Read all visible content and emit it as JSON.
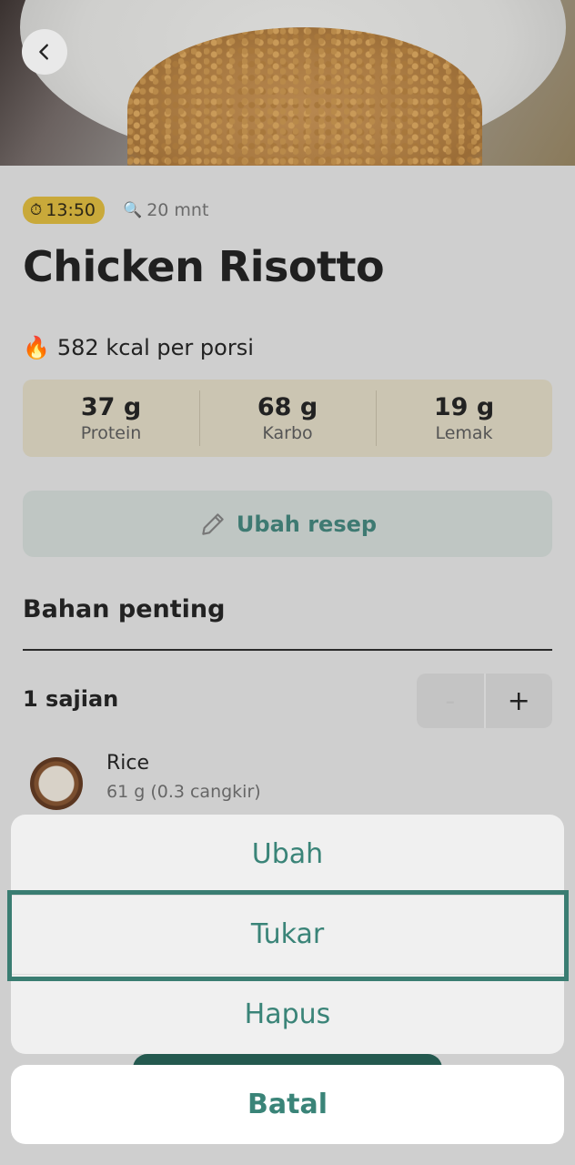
{
  "header": {
    "back_icon": "chevron-left-icon"
  },
  "meta": {
    "time": "13:50",
    "time_icon": "stopwatch-icon",
    "duration": "20 mnt",
    "duration_icon": "magnifier-icon"
  },
  "recipe": {
    "title": "Chicken Risotto",
    "calories": "582 kcal per porsi",
    "calorie_icon": "fire-icon"
  },
  "macros": [
    {
      "value": "37 g",
      "label": "Protein"
    },
    {
      "value": "68 g",
      "label": "Karbo"
    },
    {
      "value": "19 g",
      "label": "Lemak"
    }
  ],
  "edit_button": {
    "label": "Ubah resep",
    "icon": "pencil-icon"
  },
  "ingredients_section": {
    "title": "Bahan penting",
    "servings": "1 sajian",
    "minus": "-",
    "plus": "+",
    "items": [
      {
        "name": "Rice",
        "quantity": "61 g (0.3 cangkir)"
      }
    ]
  },
  "action_sheet": {
    "items": [
      "Ubah",
      "Tukar",
      "Hapus"
    ],
    "highlighted": "Tukar",
    "cancel": "Batal"
  },
  "colors": {
    "accent": "#3a8478",
    "badge": "#c9a93a",
    "macro_bg": "#cbc5b2"
  }
}
